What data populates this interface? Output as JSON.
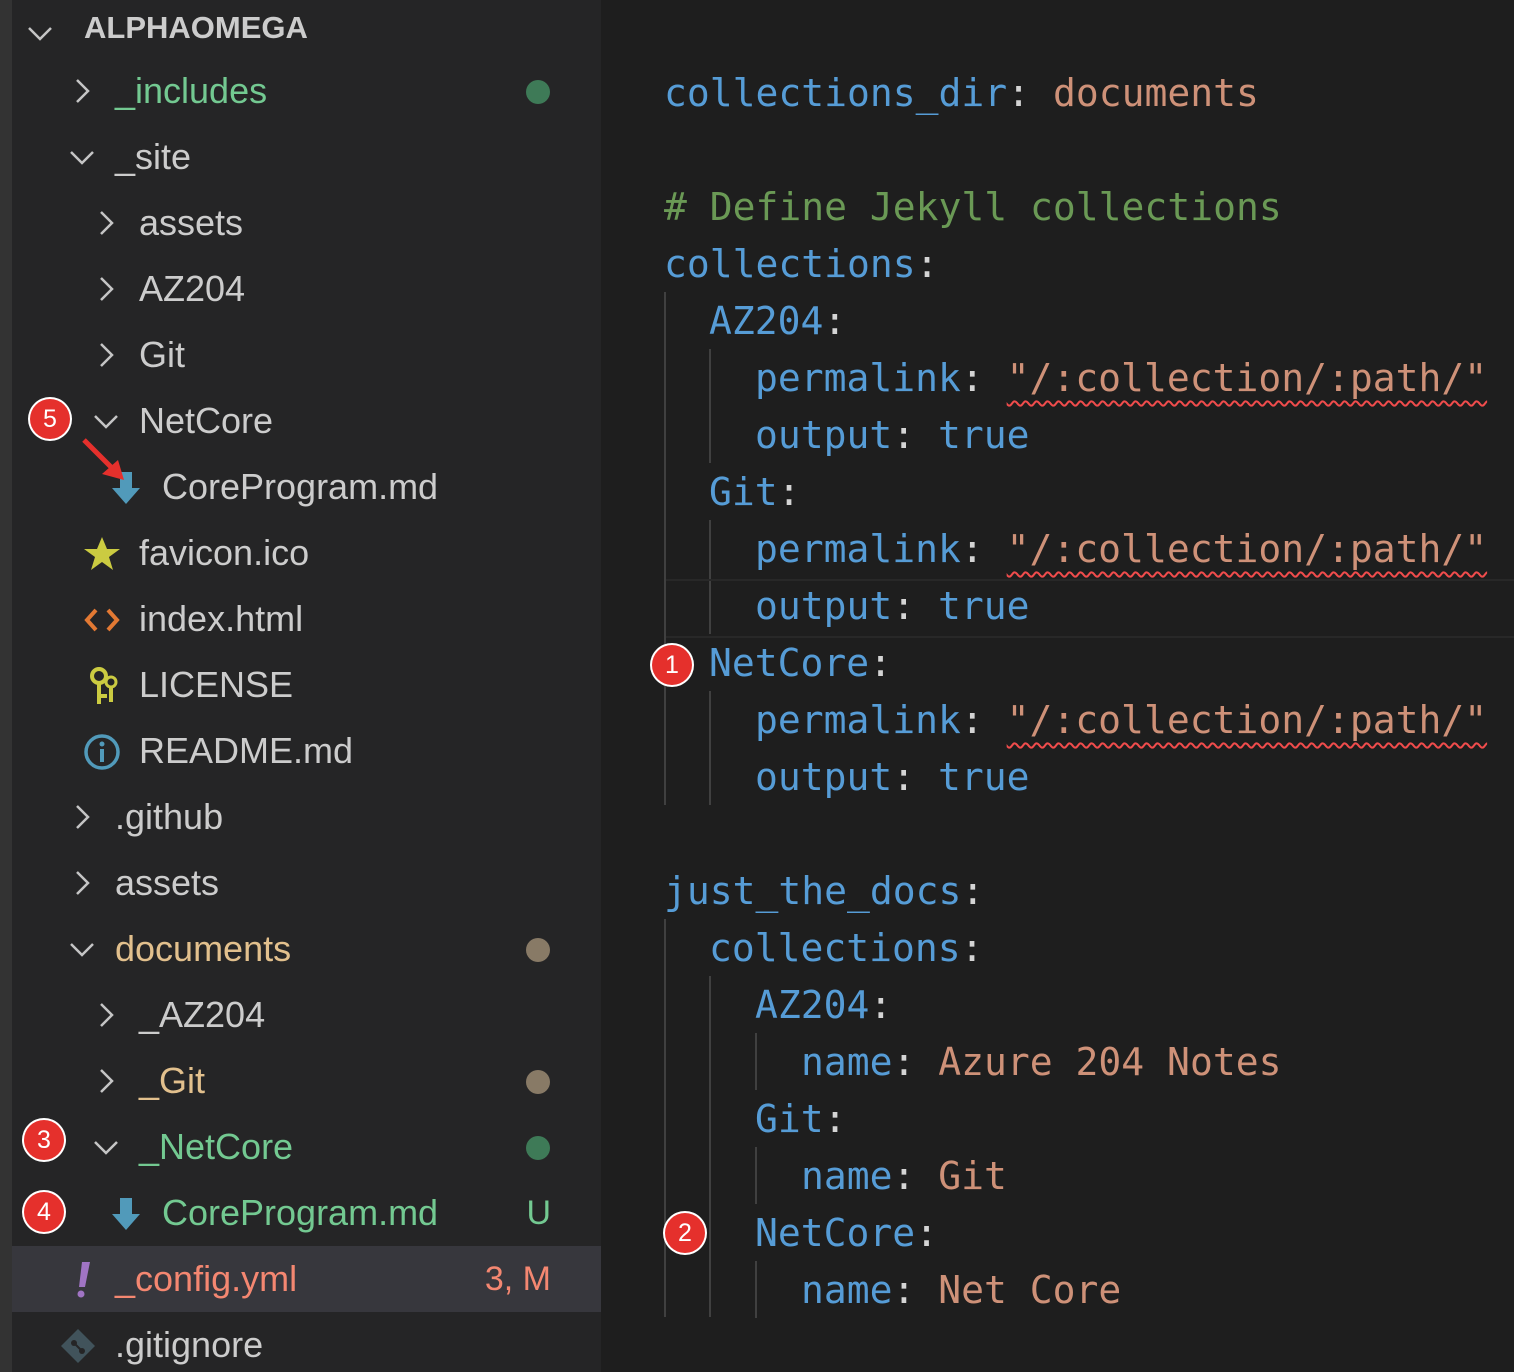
{
  "explorer": {
    "title": "ALPHAOMEGA",
    "items": [
      {
        "label": "_includes",
        "status": ""
      },
      {
        "label": "_site",
        "status": ""
      },
      {
        "label": "assets",
        "status": ""
      },
      {
        "label": "AZ204",
        "status": ""
      },
      {
        "label": "Git",
        "status": ""
      },
      {
        "label": "NetCore",
        "status": ""
      },
      {
        "label": "CoreProgram.md",
        "status": ""
      },
      {
        "label": "favicon.ico",
        "status": ""
      },
      {
        "label": "index.html",
        "status": ""
      },
      {
        "label": "LICENSE",
        "status": ""
      },
      {
        "label": "README.md",
        "status": ""
      },
      {
        "label": ".github",
        "status": ""
      },
      {
        "label": "assets",
        "status": ""
      },
      {
        "label": "documents",
        "status": ""
      },
      {
        "label": "_AZ204",
        "status": ""
      },
      {
        "label": "_Git",
        "status": ""
      },
      {
        "label": "_NetCore",
        "status": ""
      },
      {
        "label": "CoreProgram.md",
        "status": "U"
      },
      {
        "label": "_config.yml",
        "status": "3, M"
      },
      {
        "label": ".gitignore",
        "status": ""
      }
    ]
  },
  "annotations": {
    "b1": "1",
    "b2": "2",
    "b3": "3",
    "b4": "4",
    "b5": "5"
  },
  "editor": {
    "lines": [
      {
        "key": "collections_dir",
        "value": "documents"
      },
      {
        "comment": "# Define Jekyll collections"
      },
      {
        "key": "collections"
      },
      {
        "key": "AZ204"
      },
      {
        "key": "permalink",
        "value": "\"/:collection/:path/\""
      },
      {
        "key": "output",
        "value": "true"
      },
      {
        "key": "Git"
      },
      {
        "key": "permalink",
        "value": "\"/:collection/:path/\""
      },
      {
        "key": "output",
        "value": "true"
      },
      {
        "key": "NetCore"
      },
      {
        "key": "permalink",
        "value": "\"/:collection/:path/\""
      },
      {
        "key": "output",
        "value": "true"
      },
      {
        "key": "just_the_docs"
      },
      {
        "key": "collections"
      },
      {
        "key": "AZ204"
      },
      {
        "key": "name",
        "value": "Azure 204 Notes"
      },
      {
        "key": "Git"
      },
      {
        "key": "name",
        "value": "Git"
      },
      {
        "key": "NetCore"
      },
      {
        "key": "name",
        "value": "Net Core"
      }
    ]
  },
  "colors": {
    "sidebar_bg": "#252526",
    "editor_bg": "#1e1e1e",
    "selected_row": "#37373d",
    "untracked_green": "#73c991",
    "modified_yellow": "#e2c08d",
    "error_red": "#f14c4c",
    "badge_red": "#e5302c"
  }
}
